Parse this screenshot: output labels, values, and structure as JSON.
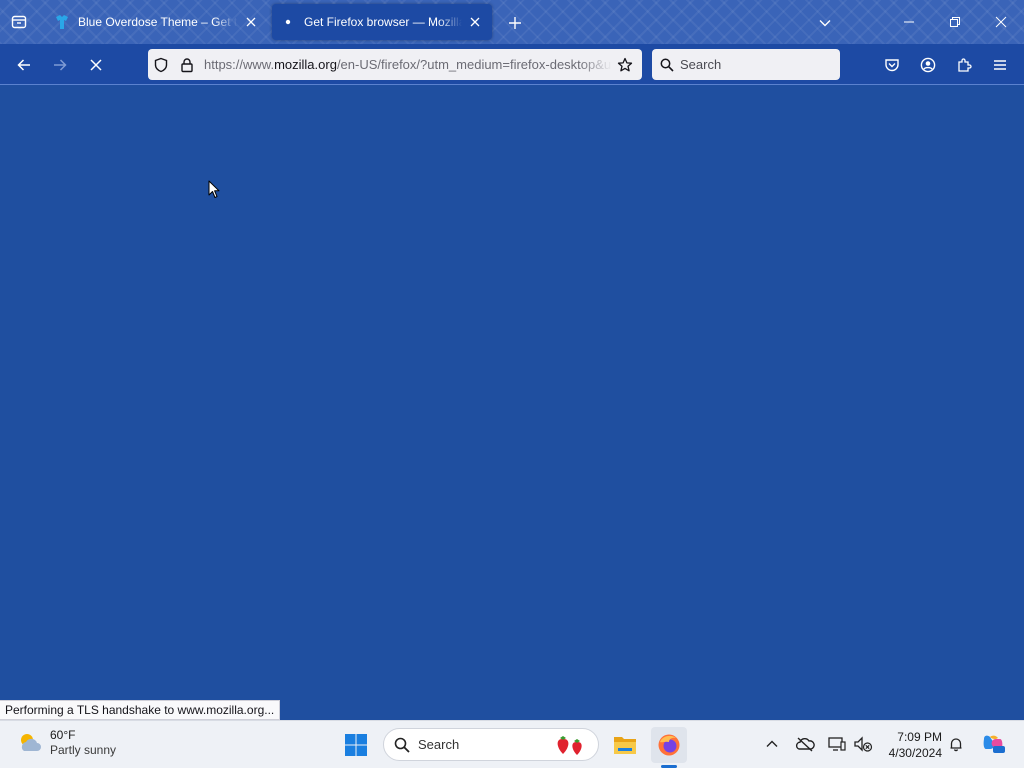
{
  "browser": {
    "tabs": [
      {
        "title": "Blue Overdose Theme – Get this Extension for Firefox",
        "icon": "theme-icon",
        "state": "inactive"
      },
      {
        "title": "Get Firefox browser — Mozilla (US)",
        "icon": "loading-dot-icon",
        "state": "active-loading"
      }
    ],
    "url": {
      "prefix": "https://www.",
      "domain": "mozilla.org",
      "suffix": "/en-US/firefox/?utm_medium=firefox-desktop&utm_source=firefox"
    },
    "search_placeholder": "Search",
    "status_text": "Performing a TLS handshake to www.mozilla.org...",
    "theme_colors": {
      "frame": "#3a64b8",
      "toolbar": "#1d4aa4",
      "content": "#1f4fa0",
      "field": "#f0f0f4"
    }
  },
  "taskbar": {
    "weather": {
      "temp": "60°F",
      "condition": "Partly sunny"
    },
    "search_placeholder": "Search",
    "clock": {
      "time": "7:09 PM",
      "date": "4/30/2024"
    },
    "pinned": [
      "start-icon",
      "file-explorer-icon",
      "firefox-icon"
    ],
    "tray": [
      "chevron-up-icon",
      "onedrive-icon",
      "display-icon",
      "network-volume-icon",
      "notification-bell-icon",
      "copilot-icon"
    ]
  }
}
